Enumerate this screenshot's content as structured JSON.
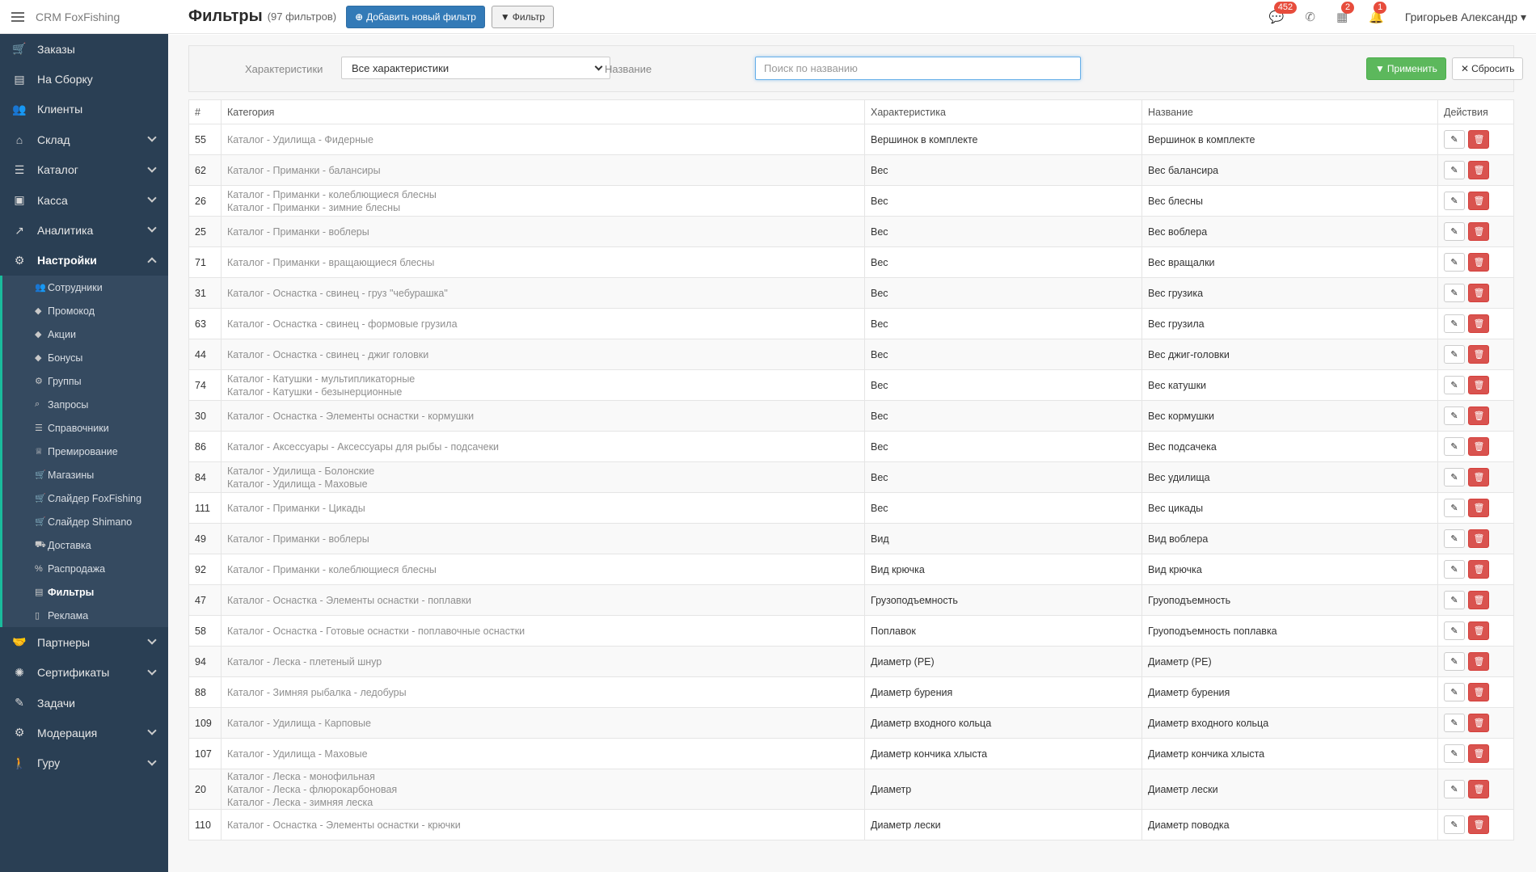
{
  "app": {
    "brand": "CRM FoxFishing"
  },
  "nav": [
    {
      "label": "Заказы",
      "icon": "cart-icon",
      "glyph": "🛒",
      "chevron": false
    },
    {
      "label": "На Сборку",
      "icon": "inbox-icon",
      "glyph": "▤",
      "chevron": false
    },
    {
      "label": "Клиенты",
      "icon": "users-icon",
      "glyph": "👥",
      "chevron": false
    },
    {
      "label": "Склад",
      "icon": "home-icon",
      "glyph": "⌂",
      "chevron": true
    },
    {
      "label": "Каталог",
      "icon": "list-icon",
      "glyph": "☰",
      "chevron": true
    },
    {
      "label": "Касса",
      "icon": "money-icon",
      "glyph": "▣",
      "chevron": true
    },
    {
      "label": "Аналитика",
      "icon": "chart-icon",
      "glyph": "↗",
      "chevron": true
    },
    {
      "label": "Настройки",
      "icon": "cogs-icon",
      "glyph": "⚙",
      "chevron": true,
      "active": true
    }
  ],
  "submenu": [
    {
      "label": "Сотрудники",
      "icon": "users-icon",
      "glyph": "👥"
    },
    {
      "label": "Промокод",
      "icon": "tag-icon",
      "glyph": "◆"
    },
    {
      "label": "Акции",
      "icon": "tags-icon",
      "glyph": "◆"
    },
    {
      "label": "Бонусы",
      "icon": "tags-icon",
      "glyph": "◆"
    },
    {
      "label": "Группы",
      "icon": "gear-icon",
      "glyph": "⚙"
    },
    {
      "label": "Запросы",
      "icon": "search-icon",
      "glyph": "⌕"
    },
    {
      "label": "Справочники",
      "icon": "list-icon",
      "glyph": "☰"
    },
    {
      "label": "Премирование",
      "icon": "trophy-icon",
      "glyph": "♕"
    },
    {
      "label": "Магазины",
      "icon": "cart-icon",
      "glyph": "🛒"
    },
    {
      "label": "Слайдер FoxFishing",
      "icon": "cart-icon",
      "glyph": "🛒"
    },
    {
      "label": "Слайдер Shimano",
      "icon": "cart-icon",
      "glyph": "🛒"
    },
    {
      "label": "Доставка",
      "icon": "truck-icon",
      "glyph": "⛟"
    },
    {
      "label": "Распродажа",
      "icon": "percent-icon",
      "glyph": "%"
    },
    {
      "label": "Фильтры",
      "icon": "list-alt-icon",
      "glyph": "▤",
      "active": true
    },
    {
      "label": "Реклама",
      "icon": "bookmark-icon",
      "glyph": "▯"
    }
  ],
  "nav_bottom": [
    {
      "label": "Партнеры",
      "icon": "handshake-icon",
      "glyph": "🤝",
      "chevron": true
    },
    {
      "label": "Сертификаты",
      "icon": "certificate-icon",
      "glyph": "✺",
      "chevron": true
    },
    {
      "label": "Задачи",
      "icon": "wrench-icon",
      "glyph": "✎",
      "chevron": false
    },
    {
      "label": "Модерация",
      "icon": "cogs-icon",
      "glyph": "⚙",
      "chevron": true
    },
    {
      "label": "Гуру",
      "icon": "walking-icon",
      "glyph": "🚶",
      "chevron": true
    }
  ],
  "header": {
    "title": "Фильтры",
    "count": "(97 фильтров)",
    "add_button": "Добавить новый фильтр",
    "filter_button": "Фильтр",
    "badges": {
      "messages": "452",
      "calendar": "2",
      "bell": "1"
    },
    "user": "Григорьев Александр"
  },
  "filters": {
    "char_label": "Характеристики",
    "char_value": "Все характеристики",
    "name_label": "Название",
    "name_placeholder": "Поиск по названию",
    "apply": "Применить",
    "reset": "Сбросить"
  },
  "table": {
    "headers": [
      "#",
      "Категория",
      "Характеристика",
      "Название",
      "Действия"
    ],
    "rows": [
      {
        "id": "55",
        "cats": [
          "Каталог - Удилища - Фидерные"
        ],
        "char": "Вершинок в комплекте",
        "name": "Вершинок в комплекте"
      },
      {
        "id": "62",
        "cats": [
          "Каталог - Приманки - балансиры"
        ],
        "char": "Вес",
        "name": "Вес балансира"
      },
      {
        "id": "26",
        "cats": [
          "Каталог - Приманки - колеблющиеся блесны",
          "Каталог - Приманки - зимние блесны"
        ],
        "char": "Вес",
        "name": "Вес блесны"
      },
      {
        "id": "25",
        "cats": [
          "Каталог - Приманки - воблеры"
        ],
        "char": "Вес",
        "name": "Вес воблера"
      },
      {
        "id": "71",
        "cats": [
          "Каталог - Приманки - вращающиеся блесны"
        ],
        "char": "Вес",
        "name": "Вес вращалки"
      },
      {
        "id": "31",
        "cats": [
          "Каталог - Оснастка - свинец - груз \"чебурашка\""
        ],
        "char": "Вес",
        "name": "Вес грузика"
      },
      {
        "id": "63",
        "cats": [
          "Каталог - Оснастка - свинец - формовые грузила"
        ],
        "char": "Вес",
        "name": "Вес грузила"
      },
      {
        "id": "44",
        "cats": [
          "Каталог - Оснастка - свинец - джиг головки"
        ],
        "char": "Вес",
        "name": "Вес джиг-головки"
      },
      {
        "id": "74",
        "cats": [
          "Каталог - Катушки - мультипликаторные",
          "Каталог - Катушки - безынерционные"
        ],
        "char": "Вес",
        "name": "Вес катушки"
      },
      {
        "id": "30",
        "cats": [
          "Каталог - Оснастка - Элементы оснастки - кормушки"
        ],
        "char": "Вес",
        "name": "Вес кормушки"
      },
      {
        "id": "86",
        "cats": [
          "Каталог - Аксессуары - Аксессуары для рыбы - подсачеки"
        ],
        "char": "Вес",
        "name": "Вес подсачека"
      },
      {
        "id": "84",
        "cats": [
          "Каталог - Удилища - Болонские",
          "Каталог - Удилища - Маховые"
        ],
        "char": "Вес",
        "name": "Вес удилища"
      },
      {
        "id": "111",
        "cats": [
          "Каталог - Приманки - Цикады"
        ],
        "char": "Вес",
        "name": "Вес цикады"
      },
      {
        "id": "49",
        "cats": [
          "Каталог - Приманки - воблеры"
        ],
        "char": "Вид",
        "name": "Вид воблера"
      },
      {
        "id": "92",
        "cats": [
          "Каталог - Приманки - колеблющиеся блесны"
        ],
        "char": "Вид крючка",
        "name": "Вид крючка"
      },
      {
        "id": "47",
        "cats": [
          "Каталог - Оснастка - Элементы оснастки - поплавки"
        ],
        "char": "Грузоподъемность",
        "name": "Груоподъемность"
      },
      {
        "id": "58",
        "cats": [
          "Каталог - Оснастка - Готовые оснастки - поплавочные оснастки"
        ],
        "char": "Поплавок",
        "name": "Груоподъемность поплавка"
      },
      {
        "id": "94",
        "cats": [
          "Каталог - Леска - плетеный шнур"
        ],
        "char": "Диаметр (PE)",
        "name": "Диаметр (PE)"
      },
      {
        "id": "88",
        "cats": [
          "Каталог - Зимняя рыбалка - ледобуры"
        ],
        "char": "Диаметр бурения",
        "name": "Диаметр бурения"
      },
      {
        "id": "109",
        "cats": [
          "Каталог - Удилища - Карповые"
        ],
        "char": "Диаметр входного кольца",
        "name": "Диаметр входного кольца"
      },
      {
        "id": "107",
        "cats": [
          "Каталог - Удилища - Маховые"
        ],
        "char": "Диаметр кончика хлыста",
        "name": "Диаметр кончика хлыста"
      },
      {
        "id": "20",
        "cats": [
          "Каталог - Леска - монофильная",
          "Каталог - Леска - флюрокарбоновая",
          "Каталог - Леска - зимняя леска"
        ],
        "char": "Диаметр",
        "name": "Диаметр лески"
      },
      {
        "id": "110",
        "cats": [
          "Каталог - Оснастка - Элементы оснастки - крючки"
        ],
        "char": "Диаметр лески",
        "name": "Диаметр поводка"
      }
    ]
  }
}
